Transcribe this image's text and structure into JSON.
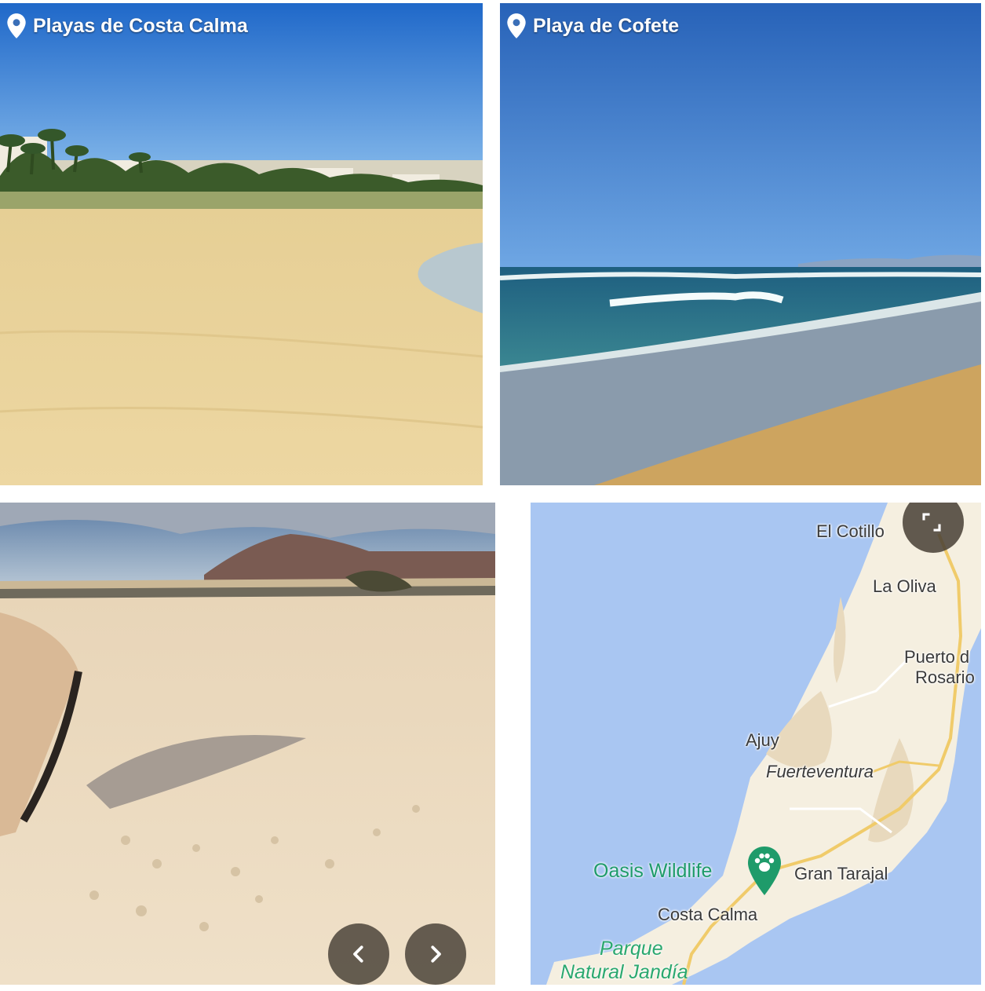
{
  "gallery": {
    "photos": [
      {
        "label": "Playas de Costa Calma",
        "icon": "location-pin-icon"
      },
      {
        "label": "Playa de Cofete",
        "icon": "location-pin-icon"
      },
      {
        "label": "",
        "icon": ""
      }
    ],
    "prev_icon": "chevron-left-icon",
    "next_icon": "chevron-right-icon"
  },
  "map": {
    "places": {
      "el_cotillo": "El Cotillo",
      "la_oliva": "La Oliva",
      "puerto_line1": "Puerto d",
      "puerto_line2": "Rosario",
      "ajuy": "Ajuy",
      "fuerteventura": "Fuerteventura",
      "oasis_wildlife": "Oasis Wildlife",
      "gran_tarajal": "Gran Tarajal",
      "costa_calma": "Costa Calma",
      "parque_line1": "Parque",
      "parque_line2": "Natural Jandía"
    },
    "poi_icon": "paw-marker-icon",
    "fullscreen_icon": "fullscreen-icon",
    "colors": {
      "ocean": "#a9c6f2",
      "land": "#f5efe0",
      "road": "#f0cb6a",
      "poi": "#1e9b6a"
    }
  }
}
